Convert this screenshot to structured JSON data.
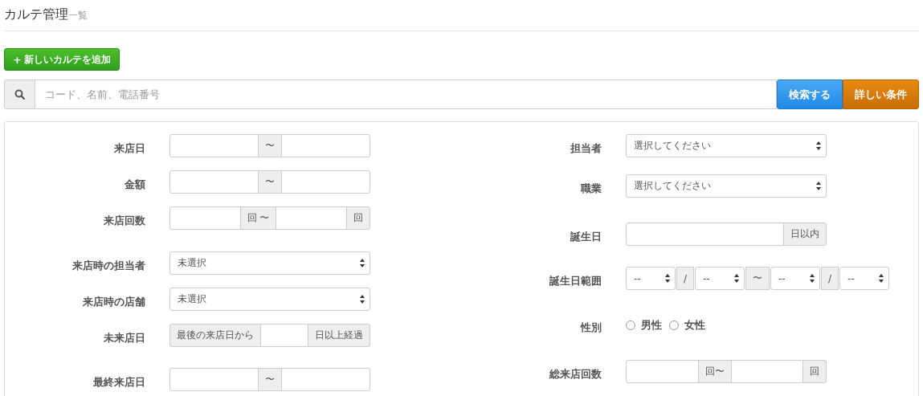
{
  "header": {
    "title": "カルテ管理",
    "subtitle": "一覧"
  },
  "add_button": {
    "icon": "+",
    "label": "新しいカルテを追加"
  },
  "search": {
    "placeholder": "コード、名前、電話番号",
    "buttons": [
      {
        "label": "検索する",
        "kind": "primary"
      },
      {
        "label": "詳しい条件",
        "kind": "warning"
      }
    ]
  },
  "filters_left": [
    {
      "label": "来店日",
      "parts": [
        {
          "kind": "input"
        },
        {
          "kind": "addon",
          "text": "〜"
        },
        {
          "kind": "input"
        }
      ]
    },
    {
      "label": "金額",
      "parts": [
        {
          "kind": "input"
        },
        {
          "kind": "addon",
          "text": "〜"
        },
        {
          "kind": "input"
        }
      ]
    },
    {
      "label": "来店回数",
      "parts": [
        {
          "kind": "input"
        },
        {
          "kind": "addon",
          "text": "回 〜"
        },
        {
          "kind": "input"
        },
        {
          "kind": "addon",
          "text": "回"
        }
      ]
    },
    {
      "label": "来店時の担当者",
      "parts": [
        {
          "kind": "select",
          "value": "未選択"
        }
      ]
    },
    {
      "label": "来店時の店舗",
      "parts": [
        {
          "kind": "select",
          "value": "未選択"
        }
      ]
    },
    {
      "label": "未来店日",
      "parts": [
        {
          "kind": "addon",
          "text": "最後の来店日から"
        },
        {
          "kind": "input"
        },
        {
          "kind": "addon",
          "text": "日以上経過"
        }
      ]
    },
    {
      "label": "最終来店日",
      "parts": [
        {
          "kind": "input"
        },
        {
          "kind": "addon",
          "text": "〜"
        },
        {
          "kind": "input"
        }
      ]
    }
  ],
  "filters_right": [
    {
      "label": "担当者",
      "parts": [
        {
          "kind": "select",
          "value": "選択してください"
        }
      ]
    },
    {
      "label": "職業",
      "parts": [
        {
          "kind": "select",
          "value": "選択してください"
        }
      ]
    },
    {
      "label": "誕生日",
      "parts": [
        {
          "kind": "input"
        },
        {
          "kind": "addon",
          "text": "日以内"
        }
      ]
    },
    {
      "label": "誕生日範囲",
      "parts": [
        {
          "kind": "select",
          "value": "--"
        },
        {
          "kind": "addon",
          "text": "/"
        },
        {
          "kind": "select",
          "value": "--"
        },
        {
          "kind": "addon",
          "text": "〜"
        },
        {
          "kind": "select",
          "value": "--"
        },
        {
          "kind": "addon",
          "text": "/"
        },
        {
          "kind": "select",
          "value": "--"
        }
      ]
    },
    {
      "label": "性別",
      "parts": [
        {
          "kind": "radio",
          "label": "男性",
          "checked": false
        },
        {
          "kind": "radio",
          "label": "女性",
          "checked": false
        }
      ]
    },
    {
      "label": "総来店回数",
      "parts": [
        {
          "kind": "input"
        },
        {
          "kind": "addon",
          "text": "回〜"
        },
        {
          "kind": "input"
        },
        {
          "kind": "addon",
          "text": "回"
        }
      ]
    }
  ]
}
